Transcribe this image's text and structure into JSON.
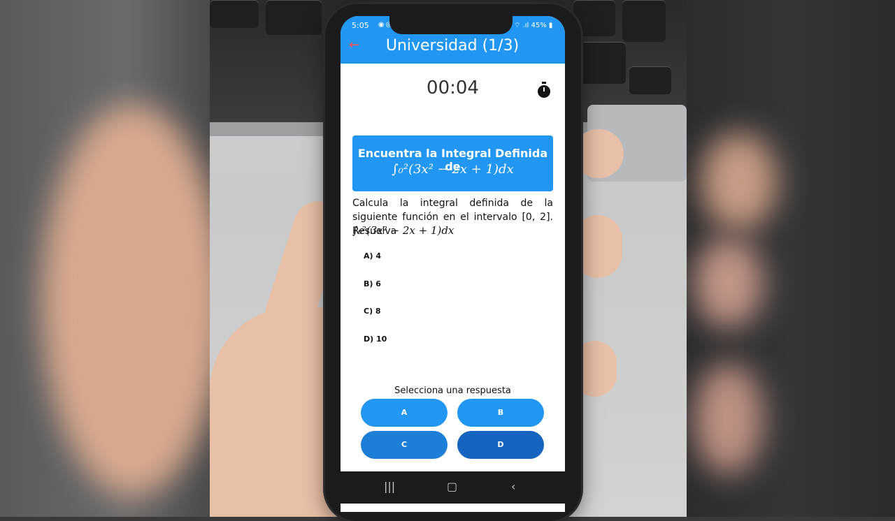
{
  "status_bar": {
    "time": "5:05",
    "battery": "45%"
  },
  "header": {
    "title": "Universidad (1/3)"
  },
  "timer": {
    "value": "00:04"
  },
  "question_card": {
    "title": "Encuentra la Integral Definida de",
    "formula": "∫₀²(3x² − 2x + 1)dx"
  },
  "question_text": "Calcula la integral definida de la siguiente función en el intervalo [0, 2]. Resuelva",
  "question_formula": "∫₀²(3x² − 2x + 1)dx",
  "options": [
    {
      "label": "A) 4"
    },
    {
      "label": "B) 6"
    },
    {
      "label": "C) 8"
    },
    {
      "label": "D) 10"
    }
  ],
  "answer_prompt": "Selecciona una respuesta",
  "answer_buttons": [
    {
      "label": "A",
      "color": "#2196f3"
    },
    {
      "label": "B",
      "color": "#2196f3"
    },
    {
      "label": "C",
      "color": "#1e7fd8"
    },
    {
      "label": "D",
      "color": "#1565c0"
    }
  ],
  "colors": {
    "appbar": "#2196f3",
    "back_arrow": "#ff5252"
  }
}
